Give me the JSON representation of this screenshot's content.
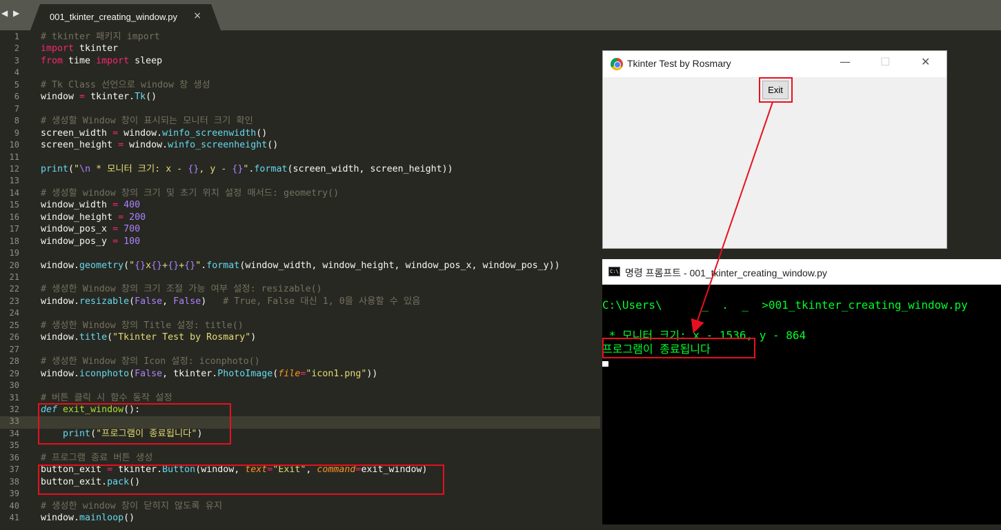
{
  "tab": {
    "nav": "◀ ▶",
    "filename": "001_tkinter_creating_window.py",
    "close": "×"
  },
  "code_lines": [
    "# tkinter 패키지 import",
    "import tkinter",
    "from time import sleep",
    "",
    "# Tk Class 선언으로 window 창 생성",
    "window = tkinter.Tk()",
    "",
    "# 생성할 Window 창이 표시되는 모니터 크기 확인",
    "screen_width = window.winfo_screenwidth()",
    "screen_height = window.winfo_screenheight()",
    "",
    "print(\"\\n * 모니터 크기: x - {}, y - {}\".format(screen_width, screen_height))",
    "",
    "# 생성할 window 창의 크기 및 초기 위치 설정 매서드: geometry()",
    "window_width = 400",
    "window_height = 200",
    "window_pos_x = 700",
    "window_pos_y = 100",
    "",
    "window.geometry(\"{}x{}+{}+{}\".format(window_width, window_height, window_pos_x, window_pos_y))",
    "",
    "# 생성한 Window 창의 크기 조절 가능 여부 설정: resizable()",
    "window.resizable(False, False)   # True, False 대신 1, 0을 사용할 수 있음",
    "",
    "# 생성한 Window 창의 Title 설정: title()",
    "window.title(\"Tkinter Test by Rosmary\")",
    "",
    "# 생성한 Window 창의 Icon 설정: iconphoto()",
    "window.iconphoto(False, tkinter.PhotoImage(file=\"icon1.png\"))",
    "",
    "# 버튼 클릭 시 함수 동작 설정",
    "def exit_window():",
    "",
    "    print(\"프로그램이 종료됩니다\")",
    "",
    "# 프로그램 종료 버튼 생성",
    "button_exit = tkinter.Button(window, text=\"Exit\", command=exit_window)",
    "button_exit.pack()",
    "",
    "# 생성한 window 창이 닫히지 않도록 유지",
    "window.mainloop()"
  ],
  "tk_window": {
    "title": "Tkinter Test by Rosmary",
    "minimize": "—",
    "maximize": "☐",
    "close": "✕",
    "exit_button": "Exit"
  },
  "cmd_window": {
    "icon": "C:\\",
    "title": "명령 프롬프트 - 001_tkinter_creating_window.py",
    "lines": [
      "C:\\Users\\      _  .  _  >001_tkinter_creating_window.py",
      "",
      " * 모니터 크기: x - 1536, y - 864",
      "프로그램이 종료됩니다"
    ]
  },
  "colors": {
    "editor_bg": "#272822",
    "tab_bar": "#56574f",
    "highlight": "#e8101e",
    "console_text": "#00ff2a"
  }
}
